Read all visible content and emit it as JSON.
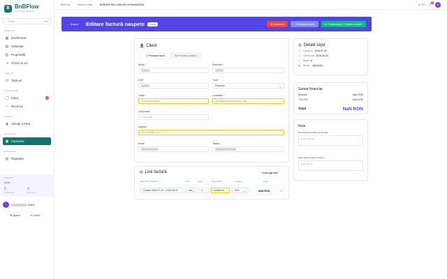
{
  "brand": {
    "name": "BnBFlow",
    "tagline": "Cloud Host Business",
    "logo": "B"
  },
  "sidebar": {
    "search_placeholder": "Caută...",
    "search_shortcut": "⌘K",
    "sec1": "Principal",
    "item_dashboard": "Dashboard",
    "item_calendar": "Calendar",
    "item_proprietati": "Proprietăți",
    "item_checkin": "Check-in-uri",
    "sec2": "Task-uri",
    "item_tasks": "Task-uri",
    "sec3": "Comunicare",
    "item_inbox": "Inbox",
    "inbox_count": "2",
    "item_recenzii": "Recenzii",
    "sec4": "Clienți",
    "item_clienti": "Clienții (CRM)",
    "sec5": "Financiar",
    "item_facturare": "Facturare",
    "sec6": "Rapoarte",
    "item_rapoarte": "Rapoarte",
    "sync": {
      "title": "Facturi",
      "status": "Activ",
      "n1": "0",
      "l1": "Facturi azi",
      "n2": "0",
      "l2": "Erori azi"
    },
    "user_suffix": "Dalia",
    "footer": {
      "settings": "Ajutor",
      "logout": "Ieșire"
    }
  },
  "topbar": {
    "bc1": "BnbFlow",
    "bc2": "Facturi emise",
    "bc3": "f4d9b4b6-f821-4dfb-bff4-447bb4a55295",
    "lang": "RO",
    "notif": "9",
    "user_initial": "A"
  },
  "header": {
    "back": "Înapoi",
    "title": "Editare factură oaspete",
    "status": "Ciornă",
    "btn_cancel": "Anulează",
    "btn_save": "Salvează ciornă",
    "btn_finalize": "Finalizează & Trimite la ANAF"
  },
  "client": {
    "title": "Client",
    "tab_pf": "Persoană fizică",
    "tab_pj": "Persoană juridică",
    "l_nume": "Nume *",
    "l_prenume": "Prenume *",
    "l_cnp": "CNP",
    "l_tara": "Țară *",
    "v_tara": "România",
    "l_judet": "Județ *",
    "ph_judet": "Selectează județul",
    "l_loc": "Localitate *",
    "ph_loc": "Selectează județul pentru listă",
    "l_cod": "Cod poștal",
    "ph_cod": "Cod poștal",
    "l_adresa": "Adresă *",
    "ph_adresa": "Str. Exemplu, nr. 1",
    "l_email": "Email",
    "l_tel": "Telefon"
  },
  "sejur": {
    "title": "Detalii sejur",
    "l_in": "Check-in:",
    "v_in": "2026-07-29",
    "l_out": "Check-out:",
    "v_out": "2026-08-04",
    "l_nopti": "Nopți:",
    "v_nopti": "6",
    "l_sursa": "Sursă:",
    "v_sursa": "BOOKING"
  },
  "sumar": {
    "title": "Sumar financiar",
    "l_sub": "Subtotal",
    "v_sub": "NaN RON",
    "l_tva": "TVA 21%",
    "v_tva": "NaN RON",
    "l_total": "Total",
    "v_total": "NaN RON"
  },
  "note": {
    "title": "Note",
    "l1": "Note factură (vizibile pe factură)",
    "ph1": "Note opționale...",
    "l2": "Note interne (doar uz intern)",
    "ph2": "Note interne..."
  },
  "lines": {
    "title": "Linii factură",
    "add": "Adaugă linie",
    "h_desc": "Descriere serviciu *",
    "h_um": "U.M.",
    "h_cant": "Cant.",
    "h_pret": "Preț unitar *",
    "h_tva": "Cotă %",
    "h_total": "Total",
    "row": {
      "desc": "Cazare 2026-07-29 - 2026-08-04",
      "um": "buc",
      "cant": "1",
      "pret": "undefined",
      "tva": "21%",
      "total": "NaN RON"
    }
  },
  "colors": {
    "accent": "#4f46e5",
    "brand": "#0f766e",
    "danger": "#ef4444",
    "success": "#10b981"
  }
}
